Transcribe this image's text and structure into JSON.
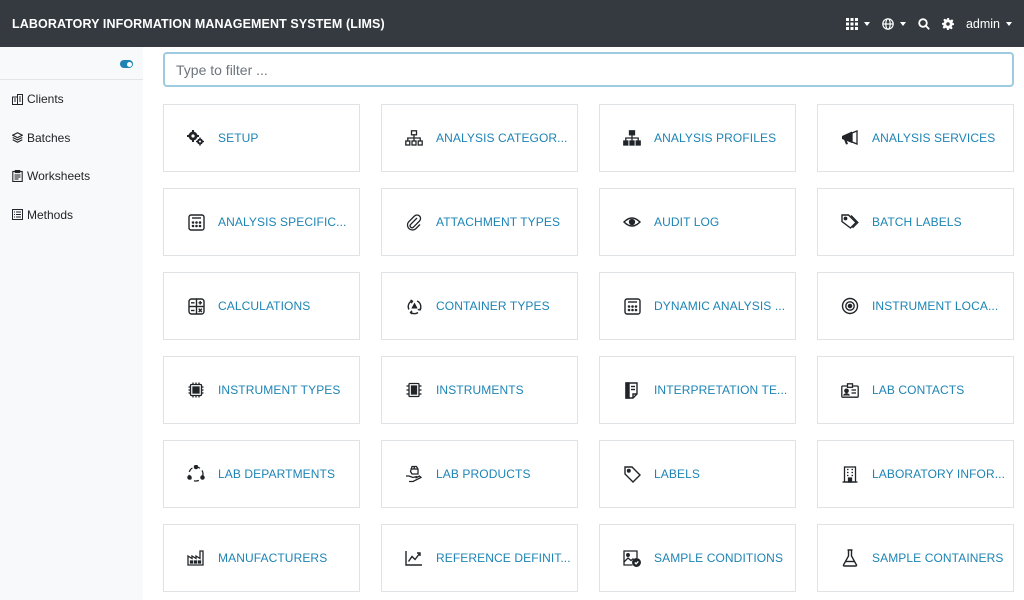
{
  "navbar": {
    "brand": "LABORATORY INFORMATION MANAGEMENT SYSTEM (LIMS)",
    "user": "admin",
    "icons": [
      "grid-icon",
      "globe-icon",
      "search-icon",
      "gear-icon"
    ]
  },
  "sidebar": {
    "toggle_state": "on",
    "items": [
      {
        "label": "Clients",
        "icon": "building-icon"
      },
      {
        "label": "Batches",
        "icon": "layers-icon"
      },
      {
        "label": "Worksheets",
        "icon": "clipboard-icon"
      },
      {
        "label": "Methods",
        "icon": "list-icon"
      }
    ]
  },
  "filter": {
    "placeholder": "Type to filter ...",
    "value": ""
  },
  "tiles": [
    {
      "label": "SETUP",
      "icon": "gears-icon"
    },
    {
      "label": "ANALYSIS CATEGOR...",
      "icon": "sitemap-icon"
    },
    {
      "label": "ANALYSIS PROFILES",
      "icon": "sitemap-icon"
    },
    {
      "label": "ANALYSIS SERVICES",
      "icon": "bullhorn-icon"
    },
    {
      "label": "ANALYSIS SPECIFIC...",
      "icon": "calculator-icon"
    },
    {
      "label": "ATTACHMENT TYPES",
      "icon": "paperclip-icon"
    },
    {
      "label": "AUDIT LOG",
      "icon": "eye-icon"
    },
    {
      "label": "BATCH LABELS",
      "icon": "tags-icon"
    },
    {
      "label": "CALCULATIONS",
      "icon": "calculator-grid-icon"
    },
    {
      "label": "CONTAINER TYPES",
      "icon": "recycle-icon"
    },
    {
      "label": "DYNAMIC ANALYSIS ...",
      "icon": "calculator-icon"
    },
    {
      "label": "INSTRUMENT LOCA...",
      "icon": "target-icon"
    },
    {
      "label": "INSTRUMENT TYPES",
      "icon": "chip-icon"
    },
    {
      "label": "INSTRUMENTS",
      "icon": "microchip-icon"
    },
    {
      "label": "INTERPRETATION TE...",
      "icon": "document-icon"
    },
    {
      "label": "LAB CONTACTS",
      "icon": "contact-card-icon"
    },
    {
      "label": "LAB DEPARTMENTS",
      "icon": "circle-dots-icon"
    },
    {
      "label": "LAB PRODUCTS",
      "icon": "hand-box-icon"
    },
    {
      "label": "LABELS",
      "icon": "tag-icon"
    },
    {
      "label": "LABORATORY INFOR...",
      "icon": "office-building-icon"
    },
    {
      "label": "MANUFACTURERS",
      "icon": "factory-icon"
    },
    {
      "label": "REFERENCE DEFINIT...",
      "icon": "chart-line-icon"
    },
    {
      "label": "SAMPLE CONDITIONS",
      "icon": "image-check-icon"
    },
    {
      "label": "SAMPLE CONTAINERS",
      "icon": "flask-icon"
    }
  ],
  "colors": {
    "navbar_bg": "#343a40",
    "accent": "#1d84b5",
    "sidebar_bg": "#f8f9fa",
    "tile_border": "#dfe3e6"
  }
}
